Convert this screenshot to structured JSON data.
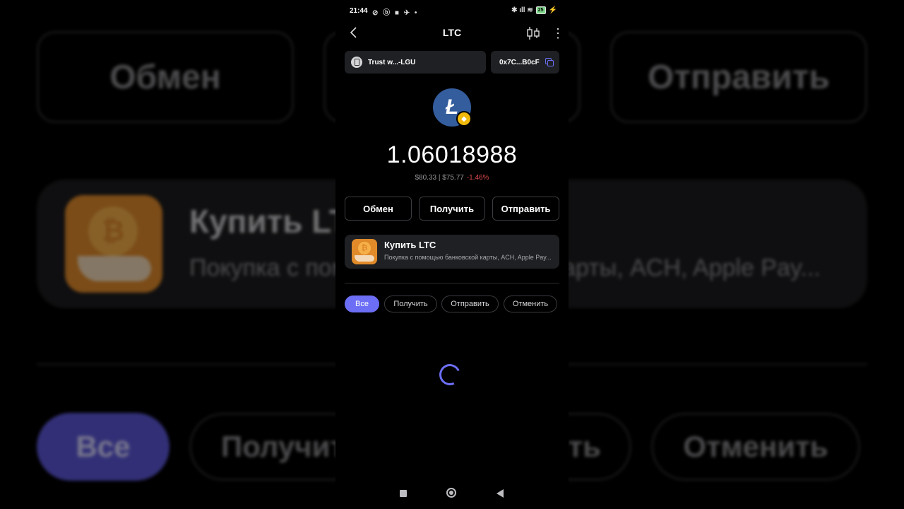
{
  "status_bar": {
    "time": "21:44",
    "left_icons": "⊘ ⓑ ■ ✈ •",
    "right_icons": "✱ ıll ≋",
    "battery": "25",
    "charging": "⚡"
  },
  "header": {
    "title": "LTC"
  },
  "wallet": {
    "name": "Trust w...-LGU",
    "address": "0x7C...B0cF"
  },
  "coin": {
    "logo_letter": "Ł",
    "badge_symbol": "◆",
    "accent": "#345d9d",
    "badge_color": "#f0b90b"
  },
  "balance": {
    "amount": "1.06018988",
    "fiat": "$80.33 | $75.77",
    "change": "-1.46%"
  },
  "actions": {
    "swap": "Обмен",
    "receive": "Получить",
    "send": "Отправить"
  },
  "buy_card": {
    "title": "Купить LTC",
    "subtitle": "Покупка с помощью банковской карты, ACH, Apple Pay...",
    "coin_glyph": "₿"
  },
  "filters": [
    {
      "label": "Все",
      "active": true
    },
    {
      "label": "Получить",
      "active": false
    },
    {
      "label": "Отправить",
      "active": false
    },
    {
      "label": "Отменить",
      "active": false
    }
  ],
  "background": {
    "swap": "Обмен",
    "send": "Отправить",
    "card_title": "Купить LTC",
    "card_sub": "Покупка с помощью банковской карты, ACH, Apple Pay...",
    "chip_all": "Все",
    "chip_receive": "Получить",
    "chip_send": "Отправить",
    "chip_cancel": "Отменить"
  },
  "colors": {
    "accent": "#6c6ff5",
    "negative": "#e24b4b",
    "card_bg": "#1e2023"
  }
}
